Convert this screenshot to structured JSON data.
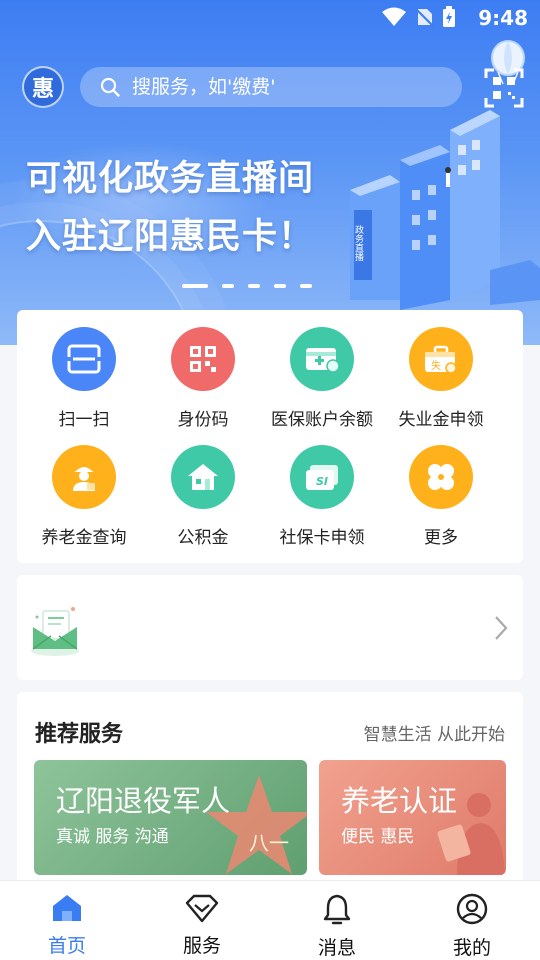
{
  "status_bar": {
    "time": "9:48"
  },
  "header": {
    "logo_text": "惠",
    "search_placeholder": "搜服务，如'缴费'"
  },
  "banner": {
    "title_line1": "可视化政务直播间",
    "title_line2": "入驻辽阳惠民卡！",
    "building_sign": "政务直播",
    "active_slide": 1,
    "slide_count": 5
  },
  "services": [
    {
      "label": "扫一扫",
      "icon": "scan-icon",
      "color": "#4a86f7"
    },
    {
      "label": "身份码",
      "icon": "qrcode-icon",
      "color": "#f06a6a"
    },
    {
      "label": "医保账户余额",
      "icon": "medical-card-icon",
      "color": "#3fc9a6"
    },
    {
      "label": "失业金申领",
      "icon": "toolbox-icon",
      "color": "#ffb11b"
    },
    {
      "label": "养老金查询",
      "icon": "elder-icon",
      "color": "#ffb11b"
    },
    {
      "label": "公积金",
      "icon": "house-icon",
      "color": "#3fc9a6"
    },
    {
      "label": "社保卡申领",
      "icon": "si-card-icon",
      "color": "#3fc9a6"
    },
    {
      "label": "更多",
      "icon": "more-grid-icon",
      "color": "#ffb11b"
    }
  ],
  "recommend": {
    "title": "推荐服务",
    "subtitle": "智慧生活 从此开始",
    "tiles": [
      {
        "title": "辽阳退役军人",
        "sub": "真诚 服务 沟通"
      },
      {
        "title": "养老认证",
        "sub": "便民 惠民"
      }
    ]
  },
  "bottom_nav": [
    {
      "label": "首页",
      "icon": "home-icon",
      "active": true
    },
    {
      "label": "服务",
      "icon": "diamond-icon",
      "active": false
    },
    {
      "label": "消息",
      "icon": "bell-icon",
      "active": false
    },
    {
      "label": "我的",
      "icon": "profile-icon",
      "active": false
    }
  ],
  "colors": {
    "accent": "#3a7cf2",
    "banner": "#4a86f5"
  }
}
